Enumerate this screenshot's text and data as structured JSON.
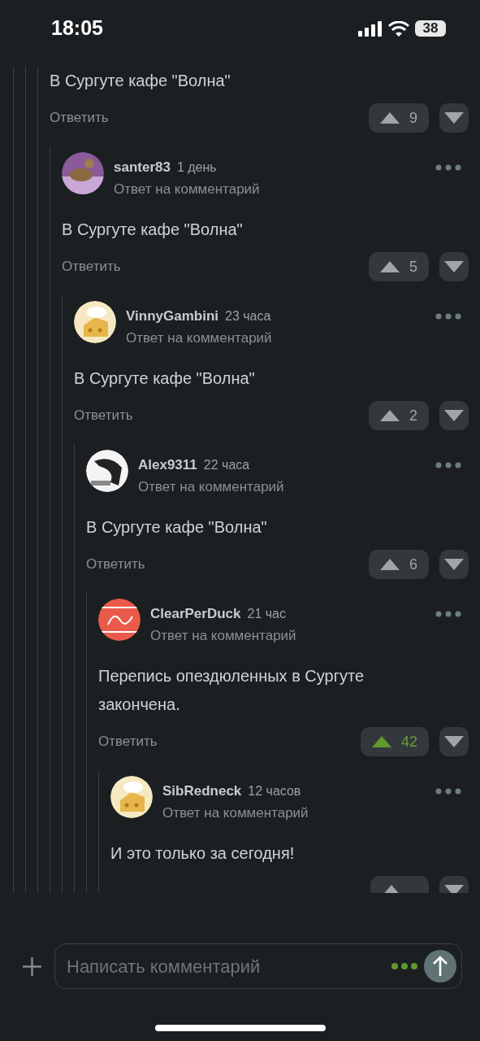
{
  "status_bar": {
    "time": "18:05",
    "battery": "38"
  },
  "thread": {
    "body": "В Сургуте кафе \"Волна\"",
    "reply": "Ответить",
    "votes": "9",
    "upvoted": false,
    "children": [
      {
        "author": "santer83",
        "time": "1 день",
        "subtitle": "Ответ на комментарий",
        "body": "В Сургуте кафе \"Волна\"",
        "reply": "Ответить",
        "votes": "5",
        "upvoted": false,
        "children": [
          {
            "author": "VinnyGambini",
            "time": "23 часа",
            "subtitle": "Ответ на комментарий",
            "body": "В Сургуте кафе \"Волна\"",
            "reply": "Ответить",
            "votes": "2",
            "upvoted": false,
            "children": [
              {
                "author": "Alex9311",
                "time": "22 часа",
                "subtitle": "Ответ на комментарий",
                "body": "В Сургуте кафе \"Волна\"",
                "reply": "Ответить",
                "votes": "6",
                "upvoted": false,
                "children": [
                  {
                    "author": "ClearPerDuck",
                    "time": "21 час",
                    "subtitle": "Ответ на комментарий",
                    "body": "Перепись опездюленных в Сургуте закончена.",
                    "reply": "Ответить",
                    "votes": "42",
                    "upvoted": true,
                    "children": [
                      {
                        "author": "SibRedneck",
                        "time": "12 часов",
                        "subtitle": "Ответ на комментарий",
                        "body": "И это только за сегодня!"
                      }
                    ]
                  }
                ]
              }
            ]
          }
        ]
      }
    ]
  },
  "composer": {
    "placeholder": "Написать комментарий"
  }
}
